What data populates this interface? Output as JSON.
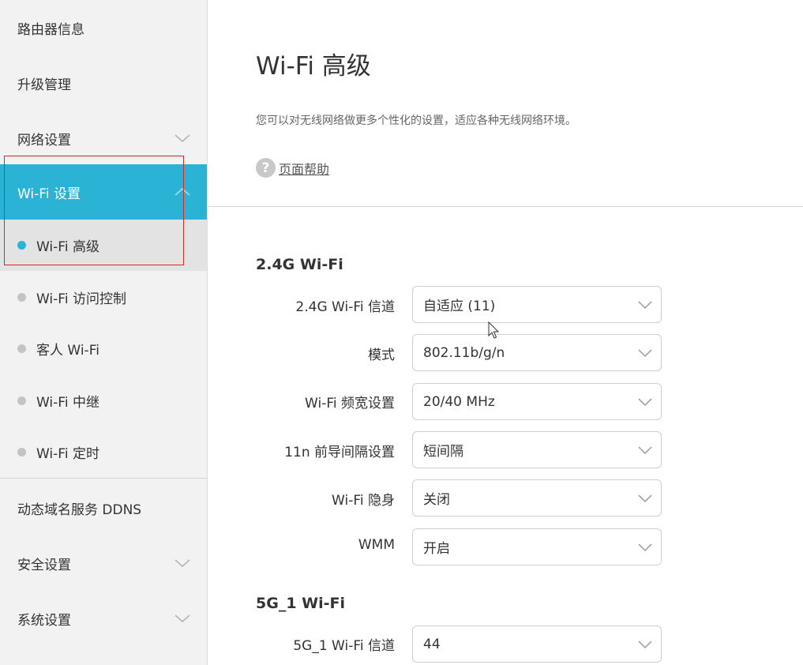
{
  "sidebar": {
    "router_info": "路由器信息",
    "upgrade": "升级管理",
    "network": "网络设置",
    "wifi_settings": "Wi-Fi 设置",
    "sub_items": [
      {
        "label": "Wi-Fi 高级"
      },
      {
        "label": "Wi-Fi 访问控制"
      },
      {
        "label": "客人 Wi-Fi"
      },
      {
        "label": "Wi-Fi 中继"
      },
      {
        "label": "Wi-Fi 定时"
      }
    ],
    "ddns": "动态域名服务 DDNS",
    "security": "安全设置",
    "system": "系统设置"
  },
  "main": {
    "title": "Wi-Fi 高级",
    "description": "您可以对无线网络做更多个性化的设置，适应各种无线网络环境。",
    "help_label": "页面帮助",
    "help_icon": "?",
    "section_24g": {
      "title": "2.4G Wi-Fi",
      "rows": [
        {
          "label": "2.4G Wi-Fi 信道",
          "value": "自适应 (11)"
        },
        {
          "label": "模式",
          "value": "802.11b/g/n"
        },
        {
          "label": "Wi-Fi 频宽设置",
          "value": "20/40 MHz"
        },
        {
          "label": "11n 前导间隔设置",
          "value": "短间隔"
        },
        {
          "label": "Wi-Fi 隐身",
          "value": "关闭"
        },
        {
          "label": "WMM",
          "value": "开启"
        }
      ]
    },
    "section_5g": {
      "title": "5G_1 Wi-Fi",
      "rows": [
        {
          "label": "5G_1 Wi-Fi 信道",
          "value": "44"
        }
      ]
    }
  },
  "colors": {
    "accent": "#2bb3d6",
    "sidebar_bg": "#f2f2f2",
    "highlight_border": "#e02424"
  }
}
